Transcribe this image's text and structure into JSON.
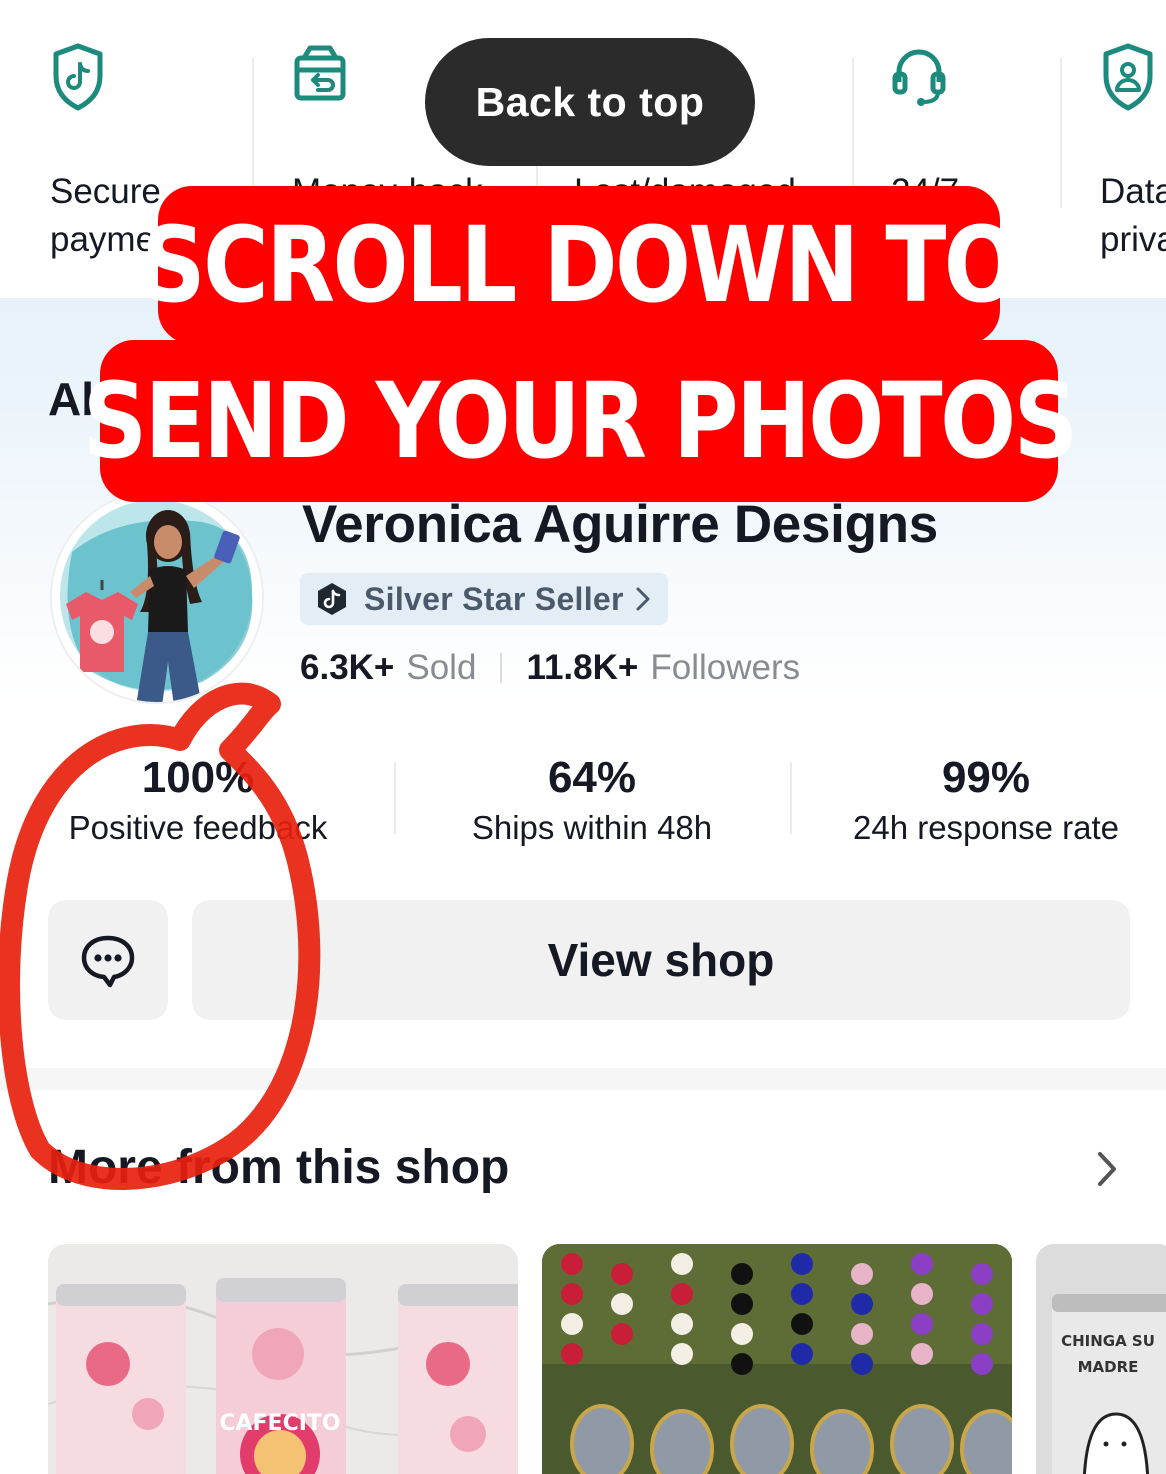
{
  "guarantees": [
    {
      "icon": "shield-tiktok-icon",
      "line1": "Secure",
      "line2": "payme"
    },
    {
      "icon": "money-back-box-icon",
      "line1": "Money-back",
      "line2": ""
    },
    {
      "icon": "shield-check-icon",
      "line1": "Lost/damaged",
      "line2": ""
    },
    {
      "icon": "headset-icon",
      "line1": "24/7",
      "line2": "rt"
    },
    {
      "icon": "shield-user-icon",
      "line1": "Data",
      "line2": "priva"
    }
  ],
  "toast": {
    "label": "Back to top"
  },
  "overlay": {
    "line1": "SCROLL DOWN TO",
    "line2": "SEND YOUR PHOTOS"
  },
  "about": {
    "title_visible": "Ab",
    "shop_name": "Veronica Aguirre Designs",
    "badge": "Silver Star Seller",
    "sold_count": "6.3K+",
    "sold_label": "Sold",
    "followers_count": "11.8K+",
    "followers_label": "Followers",
    "metrics": [
      {
        "value": "100%",
        "label": "Positive feedback"
      },
      {
        "value": "64%",
        "label": "Ships within 48h"
      },
      {
        "value": "99%",
        "label": "24h response rate"
      }
    ],
    "view_shop_label": "View shop"
  },
  "more": {
    "title": "More from this shop",
    "products": [
      {
        "name": "cafecito-tumbler",
        "text": "CAFECITO"
      },
      {
        "name": "rosary-photo-keychains",
        "text": ""
      },
      {
        "name": "chinga-su-madre-tumbler",
        "text": "CHINGA SU MADRE"
      }
    ]
  },
  "colors": {
    "accent_teal": "#1c8a7c",
    "banner_red": "#ff0000",
    "badge_bg": "#e3edf6",
    "annotation_red": "#e8210e"
  }
}
